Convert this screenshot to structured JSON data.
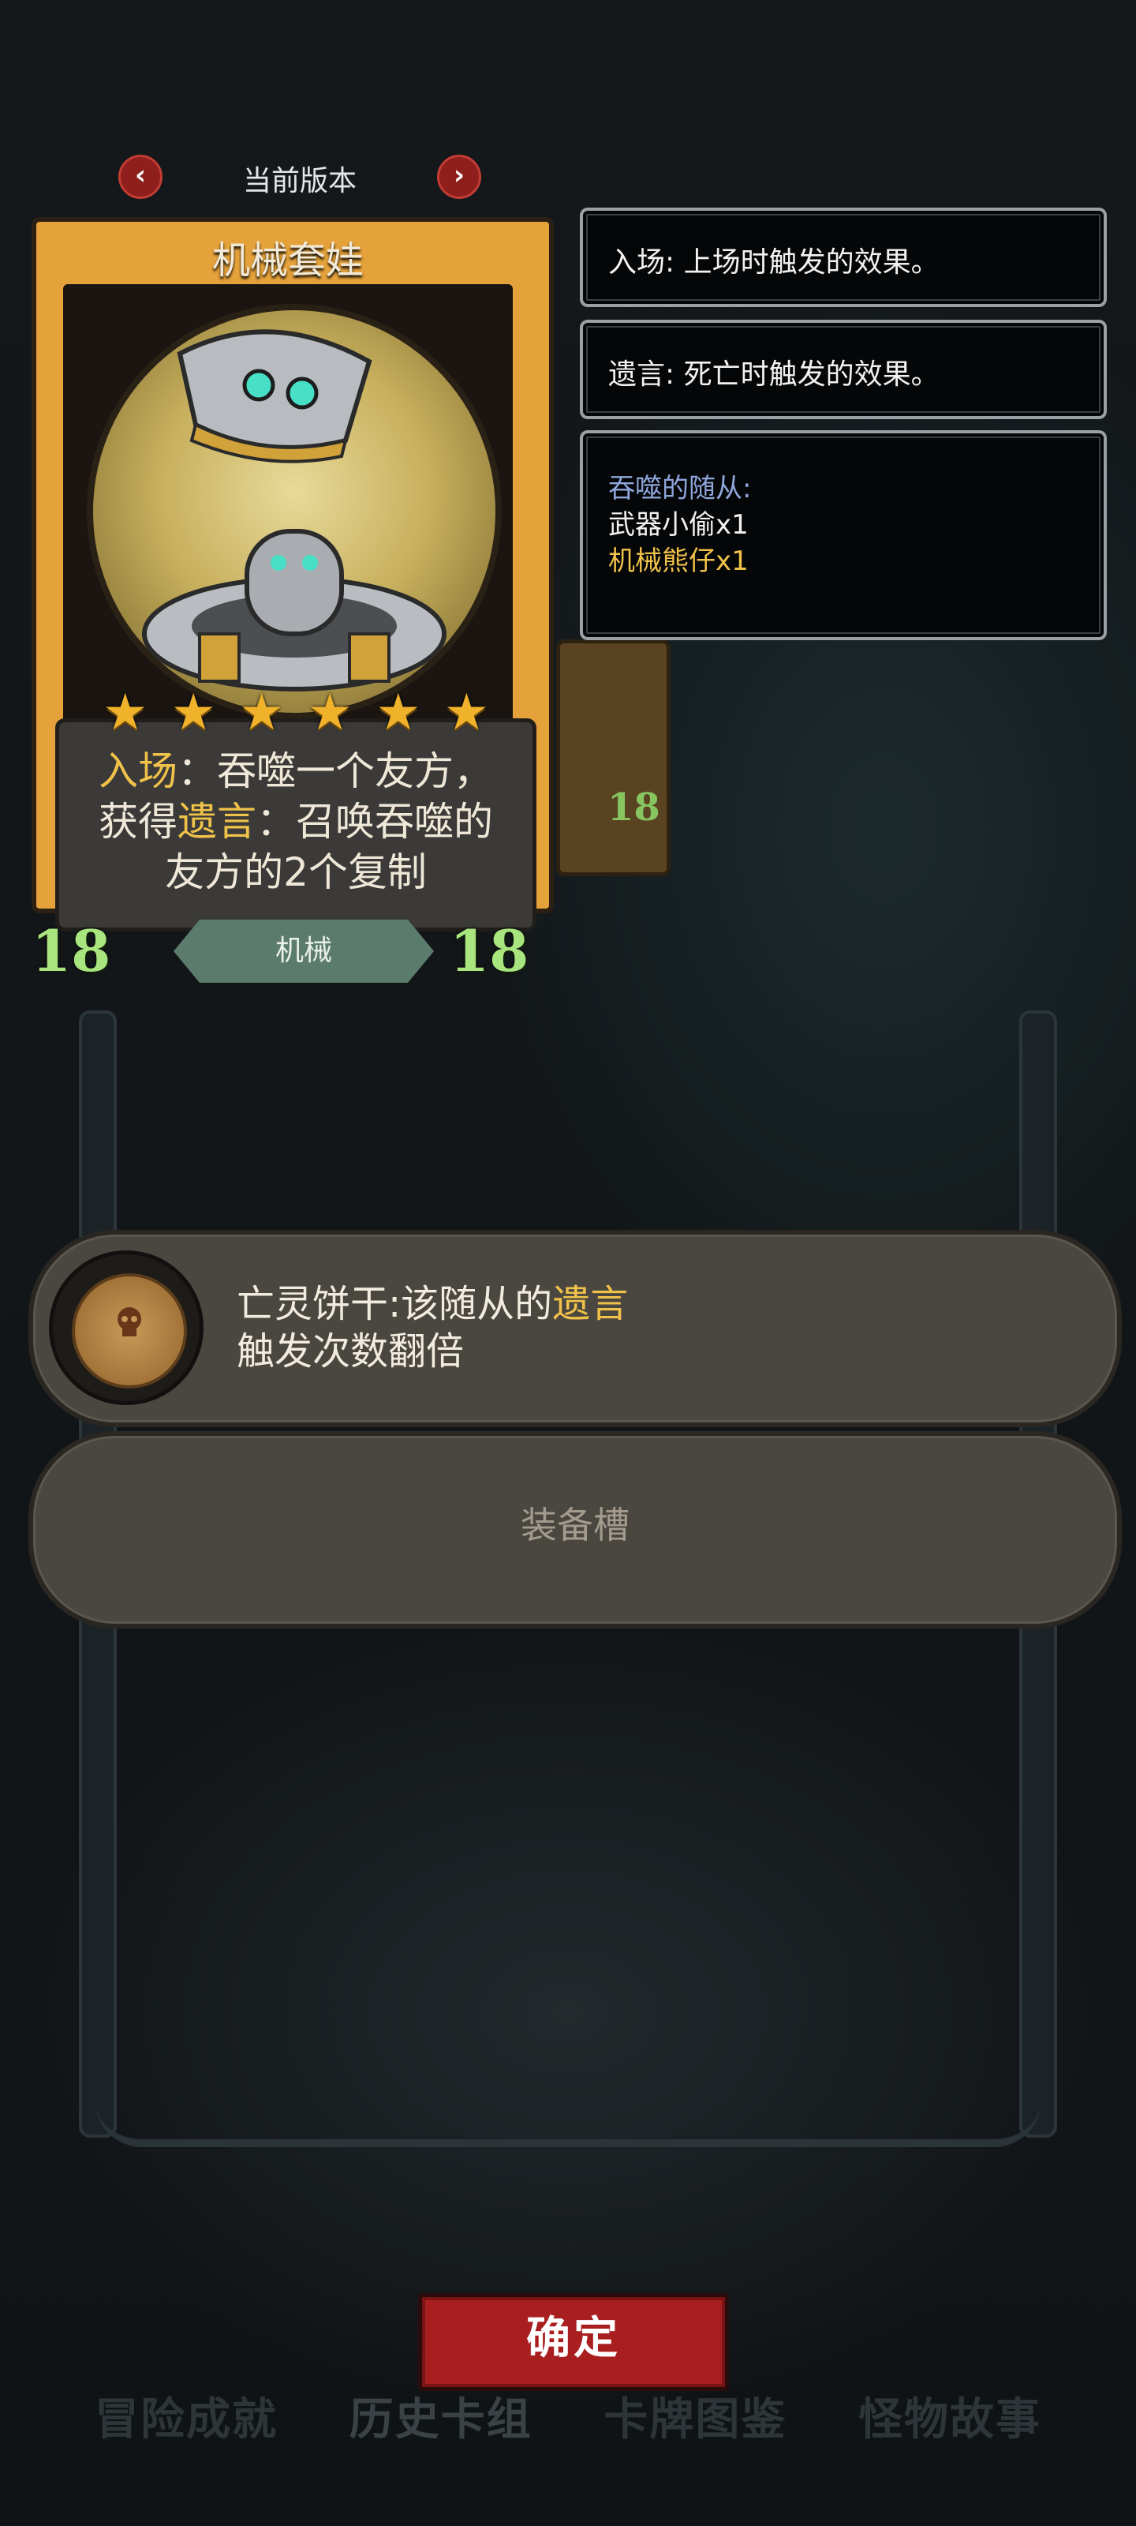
{
  "version": {
    "label": "当前版本",
    "prev_icon": "chevron-left",
    "next_icon": "chevron-right"
  },
  "card": {
    "name": "机械套娃",
    "stars": 6,
    "star_icon": "star-icon",
    "description": {
      "battlecry_keyword": "入场",
      "line1_rest": "：吞噬一个友方，",
      "line2_prefix": "获得",
      "deathrattle_keyword": "遗言",
      "line2_rest": "：召唤吞噬的",
      "line3": "友方的2个复制"
    },
    "attack": "18",
    "health": "18",
    "tribe": "机械",
    "accent_color": "#e6a23a"
  },
  "back_card": {
    "health": "18"
  },
  "tooltips": {
    "battlecry": "入场: 上场时触发的效果。",
    "deathrattle": "遗言: 死亡时触发的效果。",
    "devoured": {
      "title": "吞噬的随从:",
      "items": [
        "武器小偷x1",
        "机械熊仔x1"
      ]
    }
  },
  "equipment": {
    "slot1": {
      "icon": "skull-biscuit-icon",
      "text_prefix": "亡灵饼干:该随从的",
      "keyword": "遗言",
      "text_line2": "触发次数翻倍"
    },
    "slot2_label": "装备槽"
  },
  "confirm_label": "确定",
  "tabs": [
    "冒险成就",
    "历史卡组",
    "卡牌图鉴",
    "怪物故事"
  ]
}
